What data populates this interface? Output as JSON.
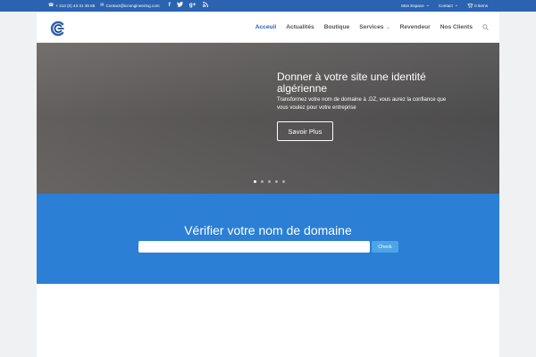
{
  "topbar": {
    "phone": "+ 213 (0) 43 31 35 86",
    "email": "Contact@iccengineering.com",
    "social": [
      {
        "icon": "facebook-icon",
        "glyph": "f"
      },
      {
        "icon": "twitter-icon",
        "glyph": "t"
      },
      {
        "icon": "google-plus-icon",
        "glyph": "g+"
      },
      {
        "icon": "rss-icon",
        "glyph": "rss"
      }
    ],
    "account_label": "Mon Espace",
    "contact_label": "Contact",
    "cart_label": "0 Items"
  },
  "nav": {
    "items": [
      {
        "label": "Acceuil",
        "active": true
      },
      {
        "label": "Actualités"
      },
      {
        "label": "Boutique"
      },
      {
        "label": "Services",
        "dropdown": true
      },
      {
        "label": "Revendeur"
      },
      {
        "label": "Nos Clients"
      }
    ]
  },
  "hero": {
    "title": "Donner à votre site une identité algérienne",
    "text": "Transformez votre nom de domaine à .DZ, vous aurez la confiance que vous voulez pour votre entreprise",
    "button": "Savoir Plus",
    "slides": 5,
    "active_slide": 0
  },
  "domain": {
    "title": "Vérifier votre nom de domaine",
    "input_value": "",
    "button": "Check"
  },
  "colors": {
    "primary": "#2b63b1",
    "domain_bg": "#2b7fd4",
    "check_button": "#4ea4e6"
  }
}
